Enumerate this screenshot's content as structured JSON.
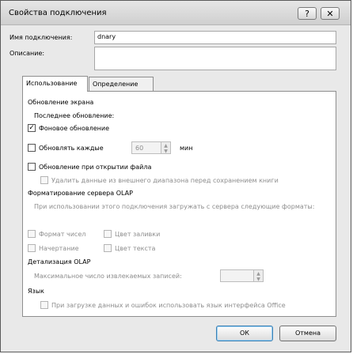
{
  "window": {
    "title": "Свойства подключения",
    "help_glyph": "?",
    "close_glyph": "✕"
  },
  "header": {
    "name_label": "Имя подключения:",
    "name_value": "dnary",
    "description_label": "Описание:",
    "description_value": ""
  },
  "tabs": [
    {
      "label": "Использование",
      "active": true
    },
    {
      "label": "Определение",
      "active": false
    }
  ],
  "usage": {
    "refresh_group": "Обновление экрана",
    "last_refresh_label": "Последнее обновление:",
    "background_refresh": {
      "label": "Фоновое обновление",
      "checked": true
    },
    "refresh_every": {
      "label": "Обновлять каждые",
      "checked": false,
      "value": "60",
      "unit": "мин"
    },
    "refresh_on_open": {
      "label": "Обновление при открытии файла",
      "checked": false
    },
    "remove_data": {
      "label": "Удалить данные из внешнего диапазона перед сохранением книги",
      "checked": false,
      "disabled": true
    },
    "olap_format_group": "Форматирование сервера OLAP",
    "olap_format_desc": "При использовании этого подключения загружать с сервера следующие форматы:",
    "olap_formats": {
      "number_format": "Формат чисел",
      "fill_color": "Цвет заливки",
      "font_style": "Начертание",
      "text_color": "Цвет текста"
    },
    "olap_drill_group": "Детализация OLAP",
    "max_records_label": "Максимальное число извлекаемых записей:",
    "max_records_value": "",
    "language_group": "Язык",
    "language_option": "При загрузке данных и ошибок использовать язык интерфейса Office"
  },
  "buttons": {
    "ok": "ОК",
    "cancel": "Отмена"
  }
}
